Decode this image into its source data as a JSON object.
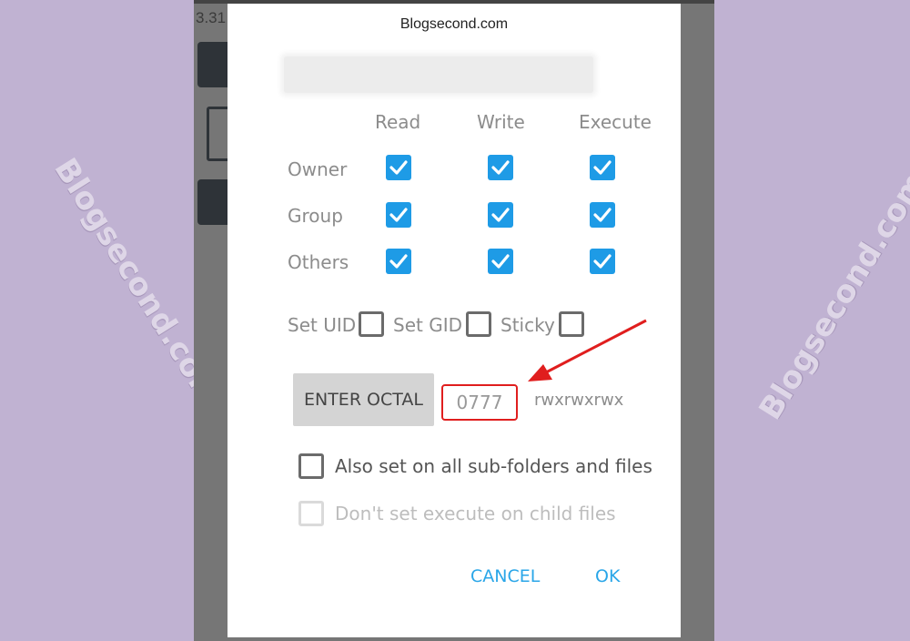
{
  "watermarks": {
    "left": "Blogsecond.com",
    "right": "Blogsecond.com"
  },
  "background_app": {
    "version_fragment": "3.31"
  },
  "dialog": {
    "site_title": "Blogsecond.com",
    "columns": [
      "Read",
      "Write",
      "Execute"
    ],
    "rows": [
      {
        "label": "Owner",
        "read": true,
        "write": true,
        "execute": true
      },
      {
        "label": "Group",
        "read": true,
        "write": true,
        "execute": true
      },
      {
        "label": "Others",
        "read": true,
        "write": true,
        "execute": true
      }
    ],
    "special_bits": {
      "set_uid": {
        "label": "Set UID",
        "checked": false
      },
      "set_gid": {
        "label": "Set GID",
        "checked": false
      },
      "sticky": {
        "label": "Sticky",
        "checked": false
      }
    },
    "enter_octal_label": "ENTER OCTAL",
    "octal_value": "0777",
    "symbolic_value": "rwxrwxrwx",
    "recursive": {
      "label": "Also set on all sub-folders and files",
      "checked": false
    },
    "no_exec_child": {
      "label": "Don't set execute on child files",
      "checked": false,
      "disabled": true
    },
    "cancel_label": "CANCEL",
    "ok_label": "OK"
  },
  "colors": {
    "checkbox_checked": "#1e9be6",
    "annotation_red": "#e01e1e",
    "action_text": "#2aa6e8",
    "page_background": "#c0b2d2"
  }
}
